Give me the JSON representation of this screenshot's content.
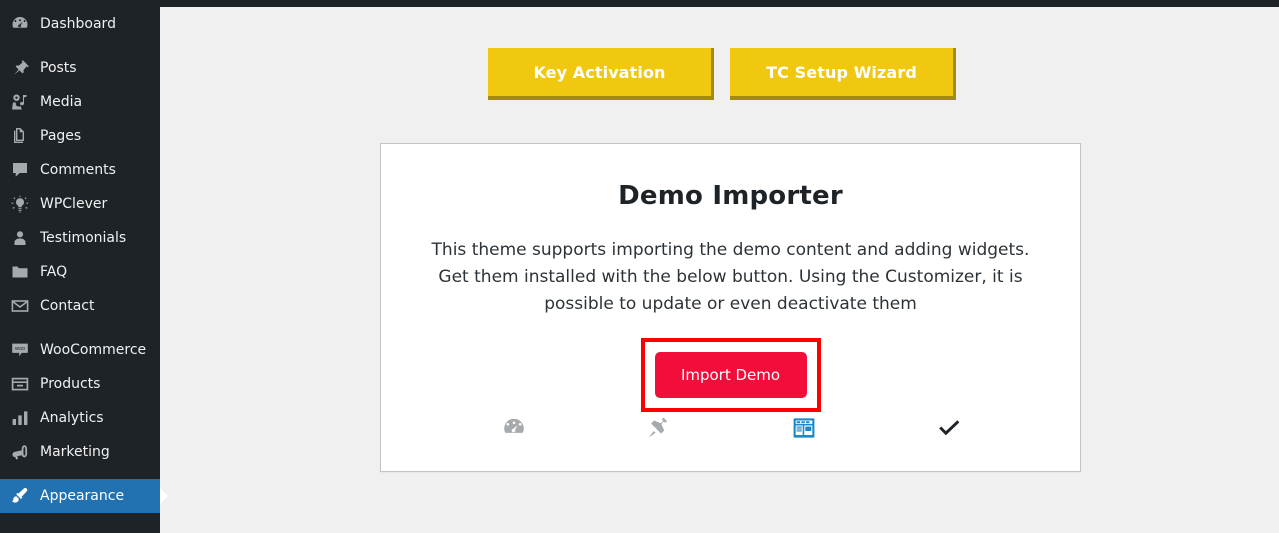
{
  "sidebar": {
    "items": [
      {
        "label": "Dashboard",
        "icon": "dashboard-icon",
        "current": false,
        "sep_after": true
      },
      {
        "label": "Posts",
        "icon": "pin-icon",
        "current": false,
        "sep_after": false
      },
      {
        "label": "Media",
        "icon": "media-icon",
        "current": false,
        "sep_after": false
      },
      {
        "label": "Pages",
        "icon": "pages-icon",
        "current": false,
        "sep_after": false
      },
      {
        "label": "Comments",
        "icon": "comments-icon",
        "current": false,
        "sep_after": false
      },
      {
        "label": "WPClever",
        "icon": "lightbulb-icon",
        "current": false,
        "sep_after": false
      },
      {
        "label": "Testimonials",
        "icon": "user-icon",
        "current": false,
        "sep_after": false
      },
      {
        "label": "FAQ",
        "icon": "folder-icon",
        "current": false,
        "sep_after": false
      },
      {
        "label": "Contact",
        "icon": "envelope-icon",
        "current": false,
        "sep_after": true
      },
      {
        "label": "WooCommerce",
        "icon": "woocommerce-icon",
        "current": false,
        "sep_after": false
      },
      {
        "label": "Products",
        "icon": "products-icon",
        "current": false,
        "sep_after": false
      },
      {
        "label": "Analytics",
        "icon": "bar-chart-icon",
        "current": false,
        "sep_after": false
      },
      {
        "label": "Marketing",
        "icon": "megaphone-icon",
        "current": false,
        "sep_after": true
      },
      {
        "label": "Appearance",
        "icon": "paintbrush-icon",
        "current": true,
        "sep_after": false
      }
    ],
    "current_color": "#2271b1",
    "background_color": "#1d2327"
  },
  "toolbar": {
    "key_activation_label": "Key Activation",
    "tc_setup_wizard_label": "TC Setup Wizard",
    "button_color": "#efc80f",
    "button_shadow_color": "#a38b11"
  },
  "card": {
    "title": "Demo Importer",
    "description": "This theme supports importing the demo content and adding widgets. Get them installed with the below button. Using the Customizer, it is possible to update or even deactivate them",
    "import_button_label": "Import Demo",
    "import_button_color": "#f20d3b",
    "highlight_color": "#ff0000",
    "steps": [
      {
        "icon": "gauge-icon",
        "state": "inactive",
        "color": "#a7aaad"
      },
      {
        "icon": "plug-icon",
        "state": "inactive",
        "color": "#a7aaad"
      },
      {
        "icon": "widgets-icon",
        "state": "active",
        "color": "#1a87c9"
      },
      {
        "icon": "check-icon",
        "state": "done",
        "color": "#1d2327"
      }
    ]
  }
}
